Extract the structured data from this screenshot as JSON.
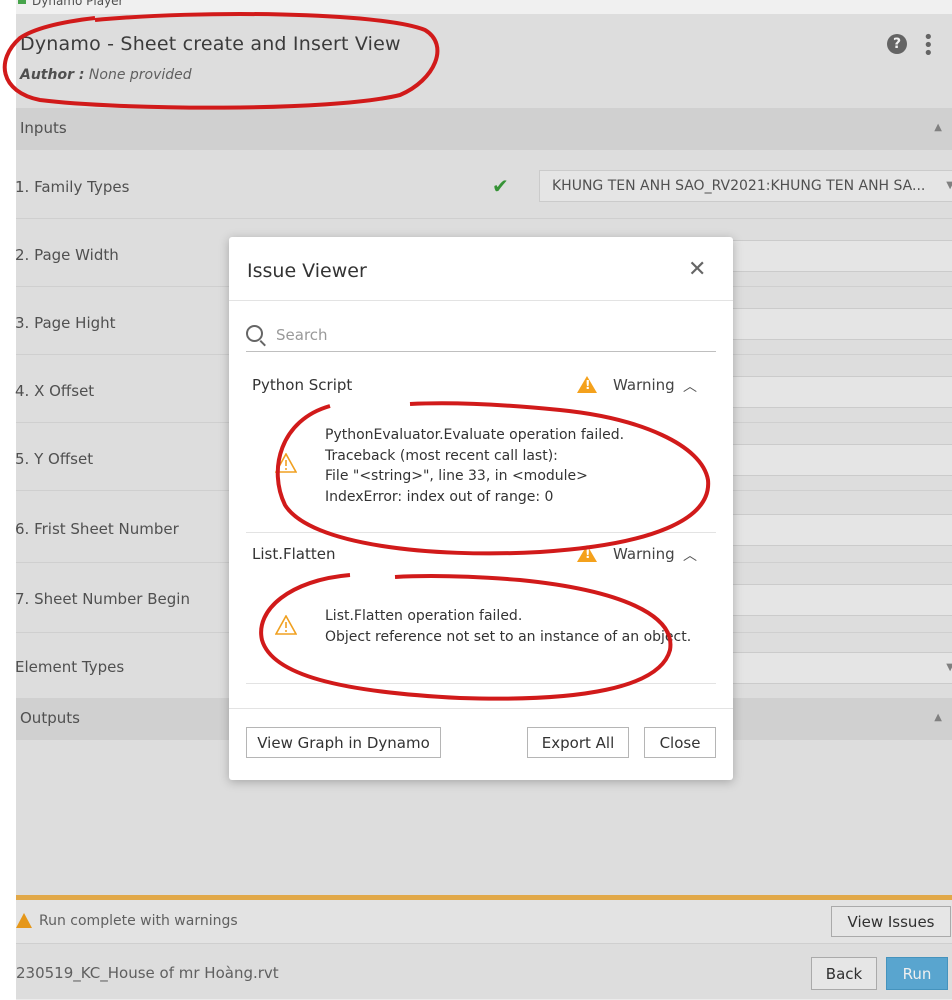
{
  "window": {
    "title": "Dynamo Player"
  },
  "header": {
    "title": "Dynamo - Sheet create and Insert View",
    "author_label": "Author :",
    "author_value": "None provided",
    "help_icon": "?",
    "menu_icon": "⋮"
  },
  "inputs": {
    "section_label": "Inputs",
    "rows": [
      {
        "label": "1. Family Types",
        "value": "KHUNG TEN ANH SAO_RV2021:KHUNG TEN ANH SA..."
      },
      {
        "label": "2. Page Width"
      },
      {
        "label": "3. Page Hight"
      },
      {
        "label": "4. X Offset"
      },
      {
        "label": "5. Y Offset"
      },
      {
        "label": "6. Frist Sheet Number"
      },
      {
        "label": "7. Sheet Number Begin"
      },
      {
        "label": "Element Types"
      }
    ]
  },
  "outputs": {
    "section_label": "Outputs"
  },
  "status": {
    "text": "Run complete with warnings",
    "view_issues_label": "View Issues"
  },
  "footer": {
    "file_name": "230519_KC_House of mr Hoàng.rvt",
    "back_label": "Back",
    "run_label": "Run"
  },
  "dialog": {
    "title": "Issue Viewer",
    "search_placeholder": "Search",
    "issues": [
      {
        "node": "Python Script",
        "severity": "Warning",
        "message": "PythonEvaluator.Evaluate operation failed.\nTraceback (most recent call last):\nFile \"<string>\", line 33, in <module>\nIndexError: index out of range: 0"
      },
      {
        "node": "List.Flatten",
        "severity": "Warning",
        "message": "List.Flatten operation failed.\nObject reference not set to an instance of an object."
      }
    ],
    "view_graph_label": "View Graph in Dynamo",
    "export_all_label": "Export All",
    "close_label": "Close"
  },
  "colors": {
    "warning": "#f4a11c",
    "run_button": "#5fb0dc",
    "annotation_red": "#d11a1a",
    "check": "#3a9d3a"
  }
}
